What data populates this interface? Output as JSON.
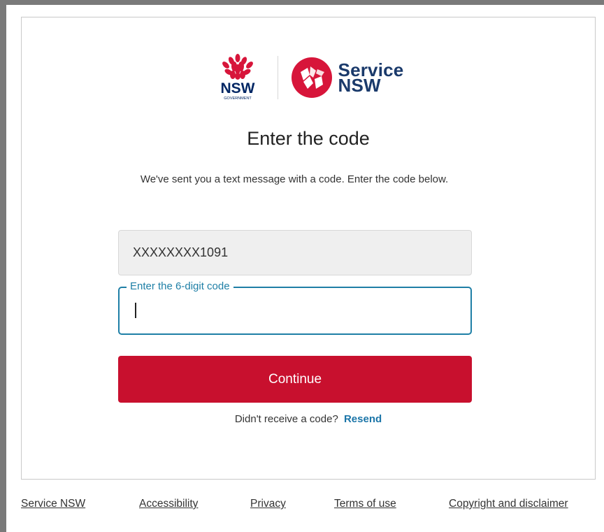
{
  "logos": {
    "nsw_government": {
      "word": "NSW",
      "sub": "GOVERNMENT"
    },
    "service_nsw": {
      "line1": "Service",
      "line2": "NSW"
    }
  },
  "page": {
    "title": "Enter the code",
    "description": "We've sent you a text message with a code. Enter the code below."
  },
  "phone": {
    "masked_value": "XXXXXXXX1091"
  },
  "code_input": {
    "label": "Enter the 6-digit code",
    "value": ""
  },
  "continue_label": "Continue",
  "resend": {
    "prompt": "Didn't receive a code?",
    "link": "Resend"
  },
  "footer": {
    "links": [
      "Service NSW",
      "Accessibility",
      "Privacy",
      "Terms of use",
      "Copyright and disclaimer"
    ]
  },
  "colors": {
    "brand_red": "#c8102e",
    "link_blue": "#1b75a8",
    "focus_blue": "#1e7fa6",
    "navy": "#1a3a6b"
  }
}
